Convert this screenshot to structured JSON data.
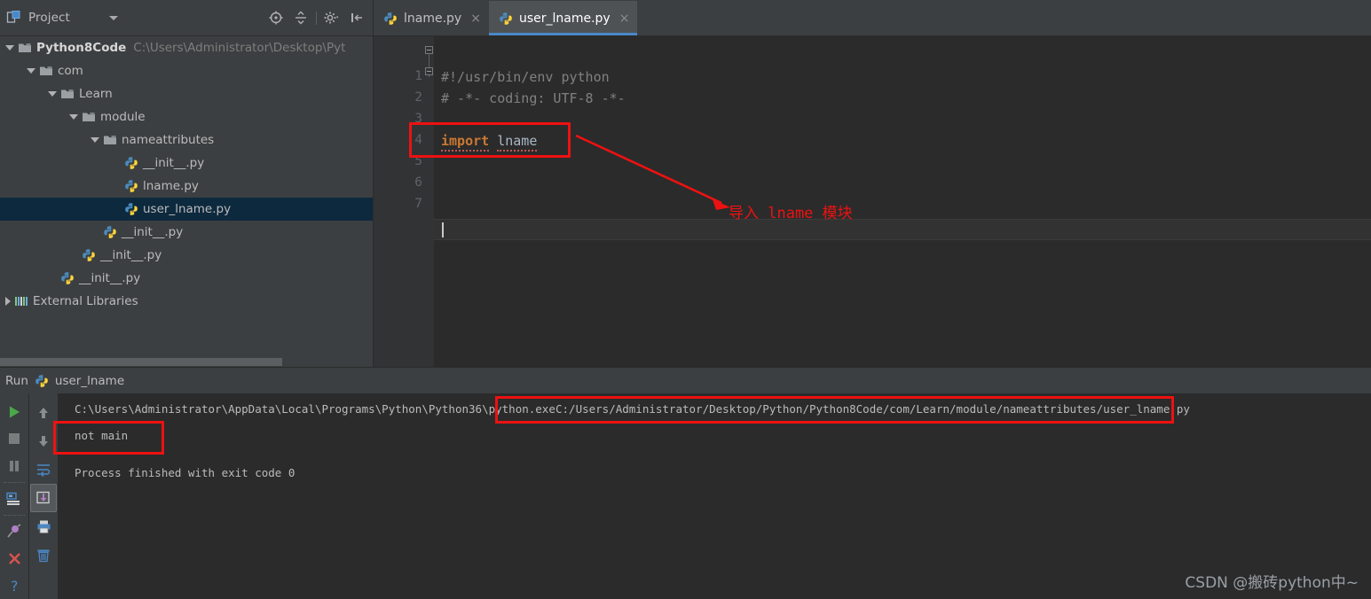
{
  "project_panel": {
    "title": "Project",
    "icons": [
      "project-icon",
      "chevron-down-icon",
      "locate-icon",
      "collapse-all-icon",
      "settings-gear-icon",
      "hide-panel-icon"
    ],
    "tree": [
      {
        "label": "Python8Code",
        "path": "C:\\Users\\Administrator\\Desktop\\Pyt",
        "depth": 0,
        "type": "folder",
        "expanded": true,
        "bold": true,
        "selected": false
      },
      {
        "label": "com",
        "path": "",
        "depth": 1,
        "type": "folder",
        "expanded": true,
        "bold": false,
        "selected": false
      },
      {
        "label": "Learn",
        "path": "",
        "depth": 2,
        "type": "folder",
        "expanded": true,
        "bold": false,
        "selected": false
      },
      {
        "label": "module",
        "path": "",
        "depth": 3,
        "type": "folder",
        "expanded": true,
        "bold": false,
        "selected": false
      },
      {
        "label": "nameattributes",
        "path": "",
        "depth": 4,
        "type": "folder",
        "expanded": true,
        "bold": false,
        "selected": false
      },
      {
        "label": "__init__.py",
        "path": "",
        "depth": 5,
        "type": "python",
        "expanded": null,
        "bold": false,
        "selected": false
      },
      {
        "label": "lname.py",
        "path": "",
        "depth": 5,
        "type": "python",
        "expanded": null,
        "bold": false,
        "selected": false
      },
      {
        "label": "user_lname.py",
        "path": "",
        "depth": 5,
        "type": "python",
        "expanded": null,
        "bold": false,
        "selected": true
      },
      {
        "label": "__init__.py",
        "path": "",
        "depth": 4,
        "type": "python",
        "expanded": null,
        "bold": false,
        "selected": false
      },
      {
        "label": "__init__.py",
        "path": "",
        "depth": 3,
        "type": "python",
        "expanded": null,
        "bold": false,
        "selected": false
      },
      {
        "label": "__init__.py",
        "path": "",
        "depth": 2,
        "type": "python",
        "expanded": null,
        "bold": false,
        "selected": false
      },
      {
        "label": "External Libraries",
        "path": "",
        "depth": 0,
        "type": "library",
        "expanded": false,
        "bold": false,
        "selected": false
      }
    ]
  },
  "editor": {
    "tabs": [
      {
        "label": "lname.py",
        "active": false,
        "close": "×"
      },
      {
        "label": "user_lname.py",
        "active": true,
        "close": "×"
      }
    ],
    "line_numbers": [
      "1",
      "2",
      "3",
      "4",
      "5",
      "6",
      "7"
    ],
    "lines": [
      {
        "n": 1,
        "text": "#!/usr/bin/env python",
        "kind": "comment"
      },
      {
        "n": 2,
        "text": "# -*- coding: UTF-8 -*-",
        "kind": "comment"
      },
      {
        "n": 3,
        "text": "",
        "kind": "blank"
      },
      {
        "n": 4,
        "keyword": "import",
        "name": "lname",
        "kind": "import"
      },
      {
        "n": 5,
        "text": "",
        "kind": "blank"
      },
      {
        "n": 6,
        "text": "",
        "kind": "blank"
      },
      {
        "n": 7,
        "text": "",
        "kind": "caret"
      }
    ],
    "annotation_text": "导入 lname 模块"
  },
  "run_panel": {
    "title": "Run",
    "config_name": "user_lname",
    "console": {
      "command_prefix": "C:\\Users\\Administrator\\AppData\\Local\\Programs\\Python\\Python36\\python.exe",
      "script_path": "C:/Users/Administrator/Desktop/Python/Python8Code/com/Learn/module/nameattributes/user_lname.py",
      "output": "not main",
      "exit_line": "Process finished with exit code 0"
    },
    "left_tools": [
      "run-icon",
      "stop-icon",
      "pause-icon",
      "show-console-icon",
      "pin-tab-icon",
      "close-icon",
      "help-icon"
    ],
    "right_tools": [
      "up-arrow-icon",
      "down-arrow-icon",
      "soft-wrap-icon",
      "scroll-to-end-icon",
      "print-icon",
      "trash-icon"
    ]
  },
  "watermark": "CSDN @搬砖python中~",
  "colors": {
    "annotation_red": "#ee1111",
    "panel_bg": "#3c3f41",
    "editor_bg": "#2b2b2b",
    "selection_blue": "#0d293e",
    "tab_underline": "#4a88c7",
    "keyword_orange": "#cc7832"
  }
}
